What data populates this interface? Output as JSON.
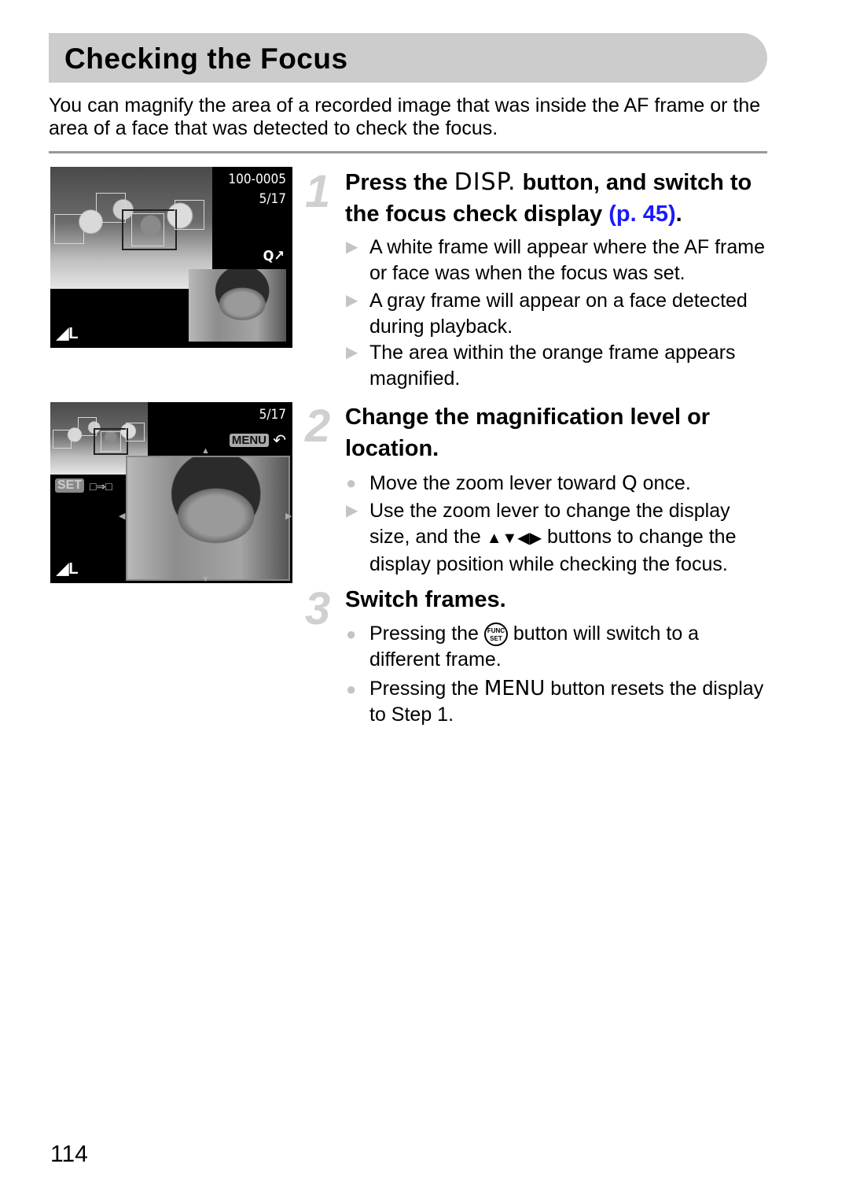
{
  "header": {
    "title": "Checking the Focus"
  },
  "intro": "You can magnify the area of a recorded image that was inside the AF frame or the area of a face that was detected to check the focus.",
  "screens": [
    {
      "file_number": "100-0005",
      "frame_count": "5/17",
      "zoom_icon": "Q↗",
      "size_icon": "L"
    },
    {
      "frame_count": "5/17",
      "menu_label": "MENU",
      "back_icon": "↶",
      "set_label": "SET",
      "switch_icon": "□⇒□",
      "size_icon": "L"
    }
  ],
  "steps": [
    {
      "number": "1",
      "title_parts": {
        "before": "Press the ",
        "button": "DISP.",
        "after": " button, and switch to the focus check display ",
        "link": "(p. 45)",
        "end": "."
      },
      "bullets": [
        {
          "type": "triangle",
          "text": "A white frame will appear where the AF frame or face was when the focus was set."
        },
        {
          "type": "triangle",
          "text": "A gray frame will appear on a face detected during playback."
        },
        {
          "type": "triangle",
          "text": "The area within the orange frame appears magnified."
        }
      ]
    },
    {
      "number": "2",
      "title": "Change the magnification level or location.",
      "bullets": [
        {
          "type": "circle",
          "before": "Move the zoom lever toward ",
          "icon": "Q",
          "after": " once."
        },
        {
          "type": "triangle",
          "before": "Use the zoom lever to change the display size, and the ",
          "icon": "▲▼◀▶",
          "after": " buttons to change the display position while checking the focus."
        }
      ]
    },
    {
      "number": "3",
      "title": "Switch frames.",
      "bullets": [
        {
          "type": "circle",
          "before": "Pressing the ",
          "icon": "FUNC SET",
          "after": " button will switch to a different frame."
        },
        {
          "type": "circle",
          "before": "Pressing the ",
          "icon": "MENU",
          "after": " button resets the display to Step 1."
        }
      ]
    }
  ],
  "page_number": "114",
  "colors": {
    "title_bar": "#cccccc",
    "link": "#1a1aff",
    "step_number": "#d0d0d0",
    "bullet_mark": "#c4c4c4"
  }
}
